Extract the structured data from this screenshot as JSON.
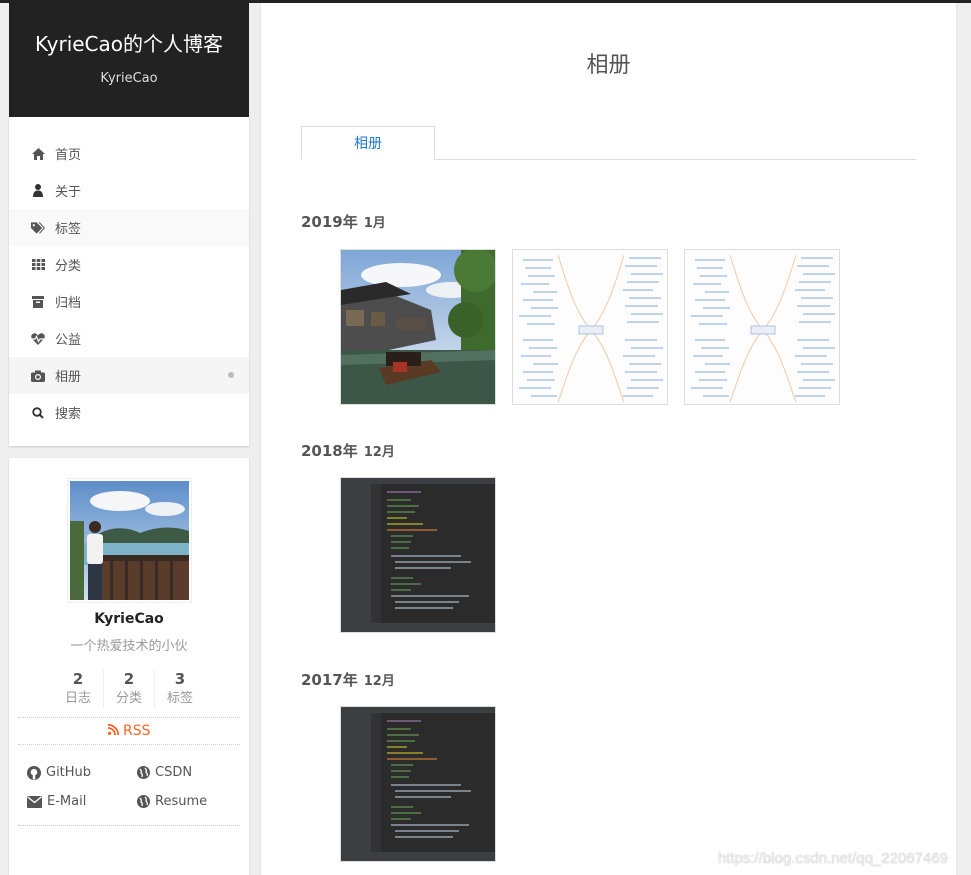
{
  "site": {
    "title": "KyrieCao的个人博客",
    "subtitle": "KyrieCao"
  },
  "menu": [
    {
      "label": "首页",
      "icon": "home-icon"
    },
    {
      "label": "关于",
      "icon": "user-icon"
    },
    {
      "label": "标签",
      "icon": "tags-icon"
    },
    {
      "label": "分类",
      "icon": "grid-icon"
    },
    {
      "label": "归档",
      "icon": "archive-icon"
    },
    {
      "label": "公益",
      "icon": "heartbeat-icon"
    },
    {
      "label": "相册",
      "icon": "camera-icon"
    },
    {
      "label": "搜索",
      "icon": "search-icon"
    }
  ],
  "profile": {
    "name": "KyrieCao",
    "description": "一个热爱技术的小伙",
    "stats": [
      {
        "num": "2",
        "label": "日志"
      },
      {
        "num": "2",
        "label": "分类"
      },
      {
        "num": "3",
        "label": "标签"
      }
    ],
    "rss": "RSS",
    "links": [
      "GitHub",
      "CSDN",
      "E-Mail",
      "Resume"
    ]
  },
  "page": {
    "title": "相册",
    "tab": "相册",
    "sections": [
      {
        "year": "2019年",
        "month": "1月"
      },
      {
        "year": "2018年",
        "month": "12月"
      },
      {
        "year": "2017年",
        "month": "12月"
      }
    ]
  },
  "watermark": "https://blog.csdn.net/qq_22067469",
  "colors": {
    "accent": "#2479cc",
    "rss": "#fc6423",
    "header": "#222222"
  }
}
